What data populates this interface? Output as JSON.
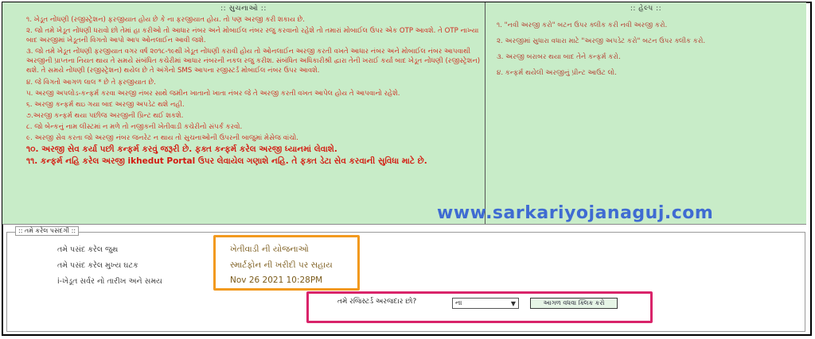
{
  "instructions": {
    "legend": ":: સુચનાઓ ::",
    "items": [
      "૧. ખેડૂત નોંધણી (રજીસ્ટ્રેશન) ફરજીયાત હોય છે કે ના ફરજીયાત હોય. તો પણ અરજી કરી શકાય છે.",
      "૨. જો તમે ખેડૂત નોંધણી ધરાવો છો તેમાં હા કરીઓ તો આધાર નંબર અને મોબાઈલ નંબર રજુ કરવાનો રહેશે તો તમારાં મોબાઈલ ઉપર એક OTP આવશે. તે OTP નાખ્યા બાદ અરજીમાં ખેડૂતની વિગતો આપો આપ ઓનલાઈન આવી જશે.",
      "૩. જો તમે ખેડૂત નોંધણી ફરજીયાત વગર વર્ષ ૨૦૧૮-૧૯થી ખેડૂત નોંધણી કરાવી હોય તો ઓનલાઈન અરજી કરતી વખતે આધાર નંબર અને મોબાઈલ નંબર આપવાથી અરજીની પ્રાપ્તના નિયત થાય તે સમયે સંબંધિત કચેરીમાં આધાર નંબરની નકલ રજુ કરીશ. સંબંધિત અધિકારીશ્રી દ્વારા તેની ખરાઈ કર્યા બાદ ખેડૂત નોંધણી (રજીસ્ટ્રેશન) થશે. તે સમયે નોંધણી (રજીસ્ટ્રેશન) થયેલ છે તે અંગેનો SMS આપના રજીસ્ટર્ડ મોબાઈલ નંબર ઉપર આવશે.",
      "૪. જે વિગતો આગળ લાલ * છે તે ફરજીયાત છે.",
      "૫. અરજી અપલોડ-કન્ફર્મ કરવા અરજી નંબર સાથે જમીન ખાતાનો ખાતા નંબર જે તે અરજી કરતી વખત આપેલ હોય તે આપવાનો રહેશે.",
      "૬. અરજી કન્ફર્મ થઇ ગયા બાદ અરજી અપડેટ થશે નહી.",
      "૭.અરજી કન્ફર્મ થયા પછીજ અરજીની પ્રિન્ટ થઈ શકશે.",
      "૮. જો બેન્કનું નામ લીસ્ટમાં ન મળે તો નજીકની ખેતીવાડી કચેરીનો સંપર્ક કરવો.",
      "૯. અરજી સેવ કરતા જો અરજી નંબર જનરેટ ન થાય તો સુચનાઓની ઉપરની બાજુમાં મેસેજ વાંચો."
    ],
    "strong_items": [
      "૧૦. અરજી સેવ કર્યા પછી કન્ફર્મ કરવું જરૂરી છે. ફક્ત કન્ફર્મ કરેલ અરજી ધ્યાનમાં લેવાશે.",
      "૧૧. કન્ફર્મ નહિ કરેલ અરજી ikhedut Portal ઉપર લેવાયેલ ગણાશે નહિ. તે ફક્ત ડેટા સેવ કરવાની સુવિધા માટે છે."
    ]
  },
  "help": {
    "legend": ":: હેલ્પ ::",
    "items": [
      "૧. \"નવી અરજી કરો\" બટન ઉપર ક્લીક કરી નવી અરજી કરો.",
      "૨. અરજીમાં સુધારા વધારા માટે \"અરજી અપડેટ કરો\" બટન ઉપર ક્લીક કરો.",
      "૩. અરજી બરાબર થયા બાદ તેને કન્ફર્મ કરો.",
      "૪. કન્ફર્મ થયેલી અરજીનું પ્રીન્ટ આઉટ લો."
    ]
  },
  "watermark": "www.sarkariyojanaguj.com",
  "selection": {
    "legend": ":: તમે કરેલ પસંદગી ::",
    "rows": [
      {
        "label": "તમે પસંદ કરેલ જુથ",
        "value": "ખેતીવાડી ની યોજનાઓ"
      },
      {
        "label": "તમે પસંદ કરેલ મુખ્ય ઘટક",
        "value": "સ્માર્ટફોન ની ખરીદી પર સહાય"
      },
      {
        "label": "i-ખેડૂત સર્વર નો તારીખ અને સમય",
        "value": "Nov 26 2021 10:28PM"
      }
    ]
  },
  "registration": {
    "question": "તમે રજિસ્ટર્ડ અરજદાર છો?",
    "selected": "ના",
    "next_button": "આગળ વધવા ક્લિક કરો"
  },
  "colors": {
    "panel_bg": "#c8ecc8",
    "instruction_text": "#d02a1e",
    "watermark": "#3f6bd2",
    "highlight_orange": "#f29a1f",
    "highlight_pink": "#d9246a"
  }
}
